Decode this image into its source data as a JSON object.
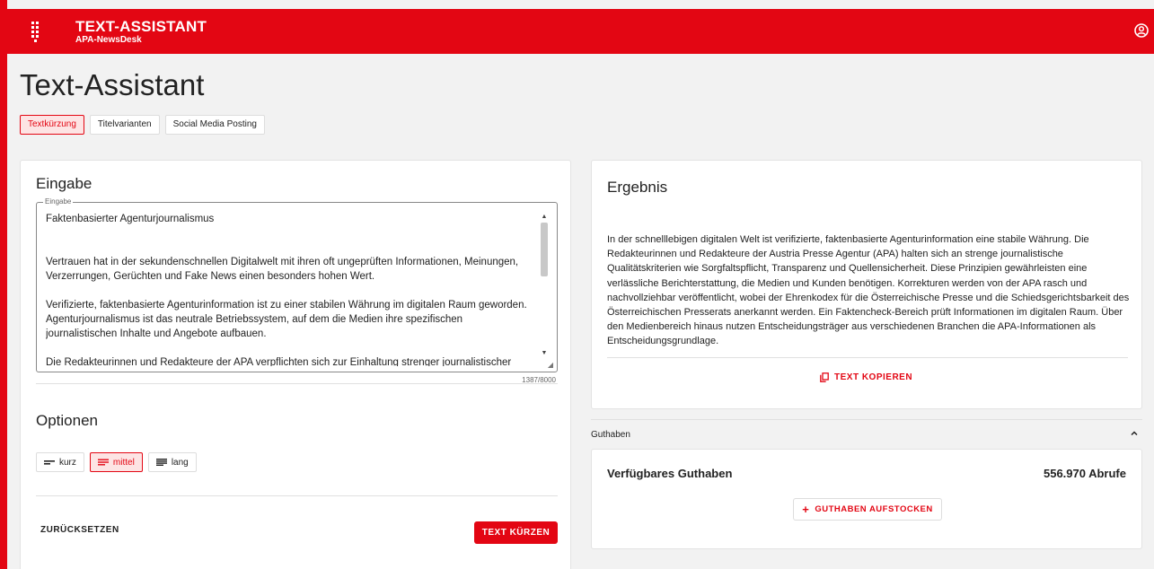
{
  "app": {
    "title": "TEXT-ASSISTANT",
    "subtitle": "APA-NewsDesk"
  },
  "page": {
    "title": "Text-Assistant"
  },
  "tabs": [
    {
      "label": "Textkürzung",
      "active": true
    },
    {
      "label": "Titelvarianten",
      "active": false
    },
    {
      "label": "Social Media Posting",
      "active": false
    }
  ],
  "input_card": {
    "title": "Eingabe",
    "field_label": "Eingabe",
    "field_value": "Faktenbasierter Agenturjournalismus\n\n\nVertrauen hat in der sekundenschnellen Digitalwelt mit ihren oft ungeprüften Informationen, Meinungen, Verzerrungen, Gerüchten und Fake News einen besonders hohen Wert.\n\nVerifizierte, faktenbasierte Agenturinformation ist zu einer stabilen Währung im digitalen Raum geworden. Agenturjournalismus ist das neutrale Betriebssystem, auf dem die Medien ihre spezifischen journalistischen Inhalte und Angebote aufbauen.\n\nDie Redakteurinnen und Redakteure der APA verpflichten sich zur Einhaltung strenger journalistischer",
    "counter": "1387/8000"
  },
  "options": {
    "title": "Optionen",
    "items": [
      {
        "label": "kurz",
        "active": false
      },
      {
        "label": "mittel",
        "active": true
      },
      {
        "label": "lang",
        "active": false
      }
    ],
    "reset_label": "ZURÜCKSETZEN",
    "submit_label": "TEXT KÜRZEN"
  },
  "result": {
    "title": "Ergebnis",
    "text": "In der schnelllebigen digitalen Welt ist verifizierte, faktenbasierte Agenturinformation eine stabile Währung. Die Redakteurinnen und Redakteure der Austria Presse Agentur (APA) halten sich an strenge journalistische Qualitätskriterien wie Sorgfaltspflicht, Transparenz und Quellensicherheit. Diese Prinzipien gewährleisten eine verlässliche Berichterstattung, die Medien und Kunden benötigen. Korrekturen werden von der APA rasch und nachvollziehbar veröffentlicht, wobei der Ehrenkodex für die Österreichische Presse und die Schiedsgerichtsbarkeit des Österreichischen Presserats anerkannt werden. Ein Faktencheck-Bereich prüft Informationen im digitalen Raum. Über den Medienbereich hinaus nutzen Entscheidungsträger aus verschiedenen Branchen die APA-Informationen als Entscheidungsgrundlage.",
    "copy_label": "TEXT KOPIEREN"
  },
  "credit": {
    "section_label": "Guthaben",
    "label": "Verfügbares Guthaben",
    "value": "556.970 Abrufe",
    "topup_label": "GUTHABEN AUFSTOCKEN"
  },
  "colors": {
    "brand": "#e30613",
    "active_bg": "#fde4e4"
  },
  "icons": [
    "apps-grid-icon",
    "user-circle-icon",
    "copy-icon",
    "plus-icon",
    "chevron-up-icon",
    "short-lines-icon",
    "medium-lines-icon",
    "long-lines-icon"
  ]
}
